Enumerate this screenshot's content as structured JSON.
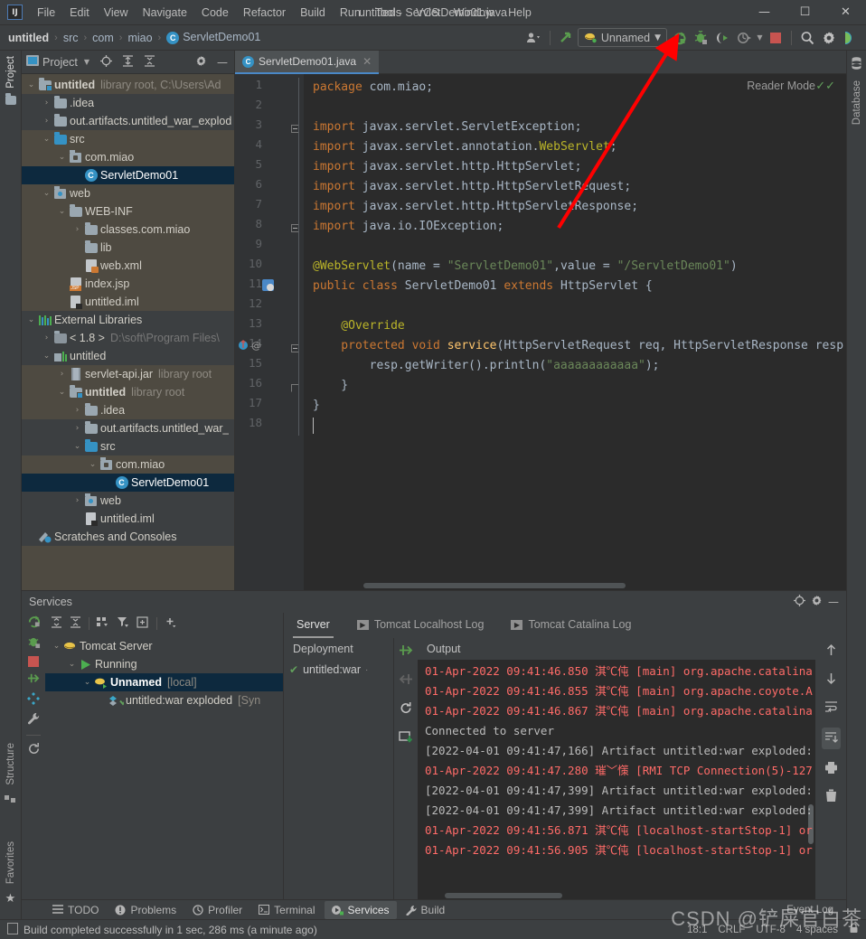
{
  "window": {
    "title": "untitled - ServletDemo01.java",
    "minimize_label": "—",
    "maximize_label": "☐",
    "close_label": "✕",
    "logo_label": "IJ"
  },
  "menu": {
    "items": [
      "File",
      "Edit",
      "View",
      "Navigate",
      "Code",
      "Refactor",
      "Build",
      "Run",
      "Tools",
      "VCS",
      "Window",
      "Help"
    ]
  },
  "breadcrumb": {
    "items": [
      "untitled",
      "src",
      "com",
      "miao",
      "ServletDemo01"
    ],
    "separator": "›",
    "class_badge": "C"
  },
  "toolbar": {
    "run_config_label": "Unnamed",
    "icons": [
      "user-settings-icon",
      "update-project-icon",
      "run-icon",
      "debug-icon",
      "run-coverage-icon",
      "profiler-icon",
      "stop-icon",
      "search-everywhere-icon",
      "settings-gear-icon",
      "ide-assistant-icon"
    ]
  },
  "left_strip": {
    "tabs": [
      "Project",
      "Structure",
      "Favorites"
    ]
  },
  "right_strip": {
    "tabs": [
      "Database"
    ]
  },
  "project_panel": {
    "title": "Project",
    "tree": [
      {
        "depth": 0,
        "arrow": "⌄",
        "icon": "module-icon",
        "label": "untitled",
        "bold": true,
        "dim": "library root,  C:\\Users\\Ad",
        "selected": false
      },
      {
        "depth": 1,
        "arrow": "›",
        "icon": "folder-icon",
        "label": ".idea",
        "bold": false,
        "dim": "",
        "selected": false
      },
      {
        "depth": 1,
        "arrow": "›",
        "icon": "folder-icon",
        "label": "out.artifacts.untitled_war_explod",
        "bold": false,
        "dim": "",
        "selected": false
      },
      {
        "depth": 1,
        "arrow": "⌄",
        "icon": "source-folder-icon",
        "label": "src",
        "bold": false,
        "dim": "",
        "selected": false
      },
      {
        "depth": 2,
        "arrow": "⌄",
        "icon": "package-icon",
        "label": "com.miao",
        "bold": false,
        "dim": "",
        "selected": false
      },
      {
        "depth": 3,
        "arrow": "",
        "icon": "java-class-icon",
        "label": "ServletDemo01",
        "bold": false,
        "dim": "",
        "selected": true
      },
      {
        "depth": 1,
        "arrow": "⌄",
        "icon": "web-folder-icon",
        "label": "web",
        "bold": false,
        "dim": "",
        "selected": false
      },
      {
        "depth": 2,
        "arrow": "⌄",
        "icon": "folder-icon",
        "label": "WEB-INF",
        "bold": false,
        "dim": "",
        "selected": false
      },
      {
        "depth": 3,
        "arrow": "›",
        "icon": "folder-icon",
        "label": "classes.com.miao",
        "bold": false,
        "dim": "",
        "selected": false
      },
      {
        "depth": 3,
        "arrow": "",
        "icon": "folder-icon",
        "label": "lib",
        "bold": false,
        "dim": "",
        "selected": false
      },
      {
        "depth": 3,
        "arrow": "",
        "icon": "xml-file-icon",
        "label": "web.xml",
        "bold": false,
        "dim": "",
        "selected": false
      },
      {
        "depth": 2,
        "arrow": "",
        "icon": "jsp-file-icon",
        "label": "index.jsp",
        "bold": false,
        "dim": "",
        "selected": false
      },
      {
        "depth": 2,
        "arrow": "",
        "icon": "iml-file-icon",
        "label": "untitled.iml",
        "bold": false,
        "dim": "",
        "selected": false
      },
      {
        "depth": 0,
        "arrow": "⌄",
        "icon": "external-libraries-icon",
        "label": "External Libraries",
        "bold": false,
        "dim": "",
        "selected": false
      },
      {
        "depth": 1,
        "arrow": "›",
        "icon": "jdk-icon",
        "label": "< 1.8 >",
        "bold": false,
        "dim": "D:\\soft\\Program Files\\",
        "selected": false
      },
      {
        "depth": 1,
        "arrow": "⌄",
        "icon": "library-icon",
        "label": "untitled",
        "bold": false,
        "dim": "",
        "selected": false
      },
      {
        "depth": 2,
        "arrow": "›",
        "icon": "jar-icon",
        "label": "servlet-api.jar",
        "bold": false,
        "dim": "library root",
        "selected": false
      },
      {
        "depth": 2,
        "arrow": "⌄",
        "icon": "module-icon",
        "label": "untitled",
        "bold": true,
        "dim": "library root",
        "selected": false
      },
      {
        "depth": 3,
        "arrow": "›",
        "icon": "folder-icon",
        "label": ".idea",
        "bold": false,
        "dim": "",
        "selected": false
      },
      {
        "depth": 3,
        "arrow": "›",
        "icon": "folder-icon",
        "label": "out.artifacts.untitled_war_",
        "bold": false,
        "dim": "",
        "selected": false
      },
      {
        "depth": 3,
        "arrow": "⌄",
        "icon": "source-folder-icon",
        "label": "src",
        "bold": false,
        "dim": "",
        "selected": false
      },
      {
        "depth": 4,
        "arrow": "⌄",
        "icon": "package-icon",
        "label": "com.miao",
        "bold": false,
        "dim": "",
        "selected": false
      },
      {
        "depth": 5,
        "arrow": "",
        "icon": "java-class-icon",
        "label": "ServletDemo01",
        "bold": false,
        "dim": "",
        "selected": true
      },
      {
        "depth": 3,
        "arrow": "›",
        "icon": "web-folder-icon",
        "label": "web",
        "bold": false,
        "dim": "",
        "selected": false
      },
      {
        "depth": 3,
        "arrow": "",
        "icon": "iml-file-icon",
        "label": "untitled.iml",
        "bold": false,
        "dim": "",
        "selected": false
      },
      {
        "depth": 0,
        "arrow": "",
        "icon": "scratches-icon",
        "label": "Scratches and Consoles",
        "bold": false,
        "dim": "",
        "selected": false
      }
    ]
  },
  "editor": {
    "tab_label": "ServletDemo01.java",
    "tab_close": "✕",
    "reader_mode": "Reader Mode",
    "inspection_ok": "✓✓",
    "lines": [
      {
        "n": 1,
        "tokens": [
          {
            "t": "package ",
            "c": "kw"
          },
          {
            "t": "com.miao;",
            "c": "plain"
          }
        ]
      },
      {
        "n": 2,
        "tokens": []
      },
      {
        "n": 3,
        "tokens": [
          {
            "t": "import ",
            "c": "kw"
          },
          {
            "t": "javax.servlet.ServletException;",
            "c": "plain"
          }
        ]
      },
      {
        "n": 4,
        "tokens": [
          {
            "t": "import ",
            "c": "kw"
          },
          {
            "t": "javax.servlet.annotation.",
            "c": "plain"
          },
          {
            "t": "WebServlet",
            "c": "ann"
          },
          {
            "t": ";",
            "c": "plain"
          }
        ]
      },
      {
        "n": 5,
        "tokens": [
          {
            "t": "import ",
            "c": "kw"
          },
          {
            "t": "javax.servlet.http.HttpServlet;",
            "c": "plain"
          }
        ]
      },
      {
        "n": 6,
        "tokens": [
          {
            "t": "import ",
            "c": "kw"
          },
          {
            "t": "javax.servlet.http.HttpServletRequest;",
            "c": "plain"
          }
        ]
      },
      {
        "n": 7,
        "tokens": [
          {
            "t": "import ",
            "c": "kw"
          },
          {
            "t": "javax.servlet.http.HttpServletResponse;",
            "c": "plain"
          }
        ]
      },
      {
        "n": 8,
        "tokens": [
          {
            "t": "import ",
            "c": "kw"
          },
          {
            "t": "java.io.IOException;",
            "c": "plain"
          }
        ]
      },
      {
        "n": 9,
        "tokens": []
      },
      {
        "n": 10,
        "tokens": [
          {
            "t": "@WebServlet",
            "c": "ann"
          },
          {
            "t": "(name = ",
            "c": "plain"
          },
          {
            "t": "\"ServletDemo01\"",
            "c": "str"
          },
          {
            "t": ",value = ",
            "c": "plain"
          },
          {
            "t": "\"/ServletDemo01\"",
            "c": "str"
          },
          {
            "t": ")",
            "c": "plain"
          }
        ]
      },
      {
        "n": 11,
        "tokens": [
          {
            "t": "public class ",
            "c": "kw"
          },
          {
            "t": "ServletDemo01 ",
            "c": "plain"
          },
          {
            "t": "extends ",
            "c": "kw"
          },
          {
            "t": "HttpServlet {",
            "c": "plain"
          }
        ]
      },
      {
        "n": 12,
        "tokens": []
      },
      {
        "n": 13,
        "tokens": [
          {
            "t": "    @Override",
            "c": "ann"
          }
        ]
      },
      {
        "n": 14,
        "tokens": [
          {
            "t": "    protected void ",
            "c": "kw"
          },
          {
            "t": "service",
            "c": "mth"
          },
          {
            "t": "(HttpServletRequest req, HttpServletResponse resp",
            "c": "plain"
          }
        ]
      },
      {
        "n": 15,
        "tokens": [
          {
            "t": "        resp.getWriter().println(",
            "c": "plain"
          },
          {
            "t": "\"aaaaaaaaaaaa\"",
            "c": "str"
          },
          {
            "t": ");",
            "c": "plain"
          }
        ]
      },
      {
        "n": 16,
        "tokens": [
          {
            "t": "    }",
            "c": "plain"
          }
        ]
      },
      {
        "n": 17,
        "tokens": [
          {
            "t": "}",
            "c": "plain"
          }
        ]
      },
      {
        "n": 18,
        "tokens": []
      }
    ]
  },
  "services": {
    "title": "Services",
    "toolbar_icons": [
      "expand-all-icon",
      "collapse-all-icon",
      "group-icon",
      "filter-icon",
      "add-frame-icon",
      "add-icon"
    ],
    "strip_icons": [
      "rerun-icon",
      "debug-icon",
      "stop-icon",
      "redeploy-icon",
      "settings-icon",
      "wrench-icon",
      "refresh-icon"
    ],
    "tree": [
      {
        "depth": 0,
        "arrow": "⌄",
        "icon": "tomcat-icon",
        "label": "Tomcat Server",
        "dim": "",
        "selected": false,
        "bold": false
      },
      {
        "depth": 1,
        "arrow": "⌄",
        "icon": "running-icon",
        "label": "Running",
        "dim": "",
        "selected": false,
        "bold": false
      },
      {
        "depth": 2,
        "arrow": "⌄",
        "icon": "tomcat-run-icon",
        "label": "Unnamed",
        "dim": "[local]",
        "selected": true,
        "bold": true
      },
      {
        "depth": 3,
        "arrow": "",
        "icon": "artifact-ok-icon",
        "label": "untitled:war exploded",
        "dim": "[Syn",
        "selected": false,
        "bold": false
      }
    ],
    "tabs": [
      {
        "label": "Server",
        "icon": "",
        "active": true
      },
      {
        "label": "Tomcat Localhost Log",
        "icon": "console-icon",
        "active": false
      },
      {
        "label": "Tomcat Catalina Log",
        "icon": "console-icon",
        "active": false
      }
    ],
    "deployment": {
      "header": "Deployment",
      "item": "untitled:war",
      "tools": [
        "deploy-icon",
        "undeploy-icon",
        "redeploy-icon",
        "download-icon"
      ]
    },
    "output": {
      "header": "Output",
      "tools": [
        "scroll-up-icon",
        "scroll-down-icon",
        "soft-wrap-icon",
        "scroll-to-end-icon",
        "print-icon",
        "clear-all-icon"
      ],
      "lines": [
        {
          "text": "01-Apr-2022 09:41:46.850 淇℃伅 [main] org.apache.catalina",
          "type": "err"
        },
        {
          "text": "01-Apr-2022 09:41:46.855 淇℃伅 [main] org.apache.coyote.A",
          "type": "err"
        },
        {
          "text": "01-Apr-2022 09:41:46.867 淇℃伅 [main] org.apache.catalina",
          "type": "err"
        },
        {
          "text": "Connected to server",
          "type": "out"
        },
        {
          "text": "[2022-04-01 09:41:47,166] Artifact untitled:war exploded:",
          "type": "out"
        },
        {
          "text": "01-Apr-2022 09:41:47.280 璀﹀憡 [RMI TCP Connection(5)-127",
          "type": "err"
        },
        {
          "text": "[2022-04-01 09:41:47,399] Artifact untitled:war exploded:",
          "type": "out"
        },
        {
          "text": "[2022-04-01 09:41:47,399] Artifact untitled:war exploded:",
          "type": "out"
        },
        {
          "text": "01-Apr-2022 09:41:56.871 淇℃伅 [localhost-startStop-1] or",
          "type": "err"
        },
        {
          "text": "01-Apr-2022 09:41:56.905 淇℃伅 [localhost-startStop-1] or",
          "type": "err"
        }
      ]
    }
  },
  "bottom_tabs": [
    {
      "label": "TODO",
      "icon": "todo-icon",
      "active": false
    },
    {
      "label": "Problems",
      "icon": "problems-icon",
      "active": false
    },
    {
      "label": "Profiler",
      "icon": "profiler-icon",
      "active": false
    },
    {
      "label": "Terminal",
      "icon": "terminal-icon",
      "active": false
    },
    {
      "label": "Services",
      "icon": "services-icon",
      "active": true
    },
    {
      "label": "Build",
      "icon": "build-icon",
      "active": false
    }
  ],
  "status_bar": {
    "message": "Build completed successfully in 1 sec, 286 ms (a minute ago)",
    "caret": "18:1",
    "line_sep": "CRLF",
    "encoding": "UTF-8",
    "indent": "4 spaces",
    "event_log": "Event Log"
  },
  "watermark": "CSDN @铲屎官白茶",
  "colors": {
    "accent_blue": "#3592c4",
    "selection": "#0d293e",
    "panel_olive": "#4e4a41",
    "editor_bg": "#2b2b2b",
    "error_red": "#ff6b68",
    "string_green": "#6a8759",
    "keyword_orange": "#cc7832",
    "annotation_yellow": "#bbb529",
    "annot_arrow": "#ff0000"
  }
}
